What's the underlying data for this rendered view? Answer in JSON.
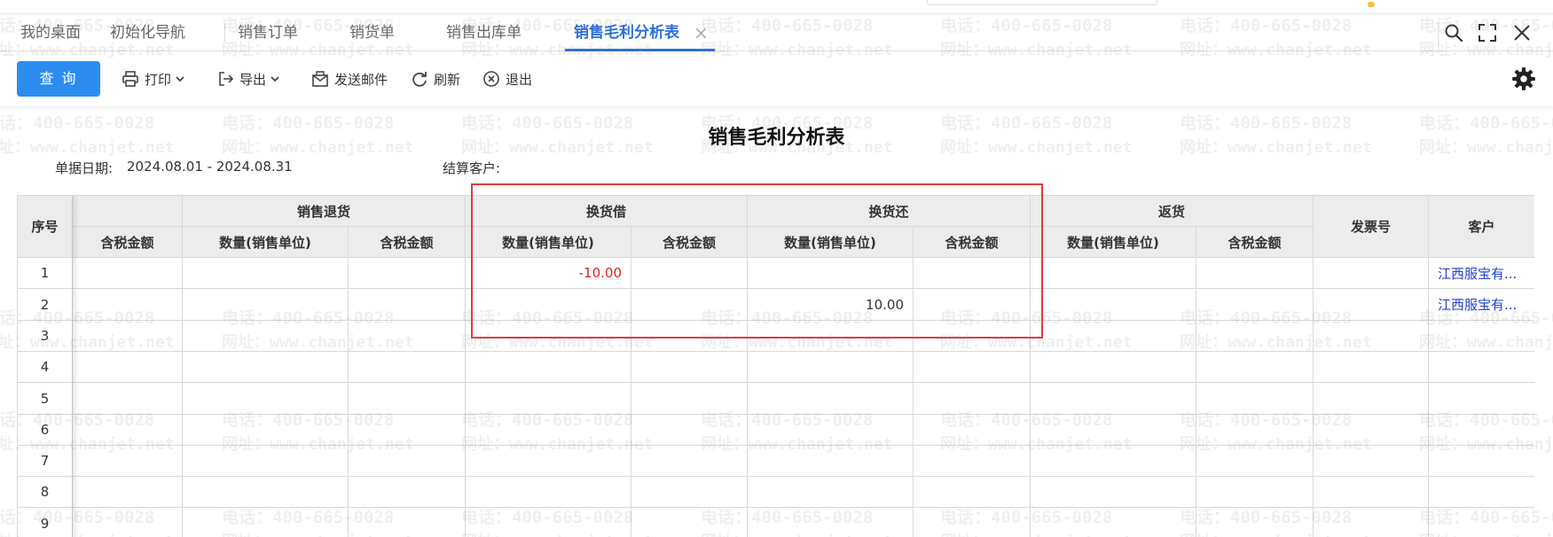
{
  "tabs": [
    {
      "label": "我的桌面",
      "active": false
    },
    {
      "label": "初始化导航",
      "active": false
    },
    {
      "label": "销售订单",
      "active": false
    },
    {
      "label": "销货单",
      "active": false
    },
    {
      "label": "销售出库单",
      "active": false
    },
    {
      "label": "销售毛利分析表",
      "active": true
    }
  ],
  "window_controls": [
    "search-icon",
    "maximize-icon",
    "close-icon"
  ],
  "toolbar": {
    "query_label": "查 询",
    "print_label": "打印",
    "export_label": "导出",
    "email_label": "发送邮件",
    "refresh_label": "刷新",
    "exit_label": "退出"
  },
  "report": {
    "title": "销售毛利分析表",
    "date_label": "单据日期:",
    "date_value": "2024.08.01 - 2024.08.31",
    "customer_label": "结算客户:",
    "customer_value": ""
  },
  "grid": {
    "seq_header": "序号",
    "groups": [
      "销售退货",
      "换货借",
      "换货还",
      "返货"
    ],
    "amount_header": "含税金额",
    "qty_header": "数量(销售单位)",
    "invoice_header": "发票号",
    "customer_header": "客户",
    "rows": [
      {
        "seq": "1",
        "exchange_borrow_qty": "-10.00",
        "exchange_return_qty": "",
        "customer": "江西服宝有..."
      },
      {
        "seq": "2",
        "exchange_borrow_qty": "",
        "exchange_return_qty": "10.00",
        "customer": "江西服宝有..."
      },
      {
        "seq": "3",
        "exchange_borrow_qty": "",
        "exchange_return_qty": "",
        "customer": ""
      },
      {
        "seq": "4",
        "exchange_borrow_qty": "",
        "exchange_return_qty": "",
        "customer": ""
      },
      {
        "seq": "5",
        "exchange_borrow_qty": "",
        "exchange_return_qty": "",
        "customer": ""
      },
      {
        "seq": "6",
        "exchange_borrow_qty": "",
        "exchange_return_qty": "",
        "customer": ""
      },
      {
        "seq": "7",
        "exchange_borrow_qty": "",
        "exchange_return_qty": "",
        "customer": ""
      },
      {
        "seq": "8",
        "exchange_borrow_qty": "",
        "exchange_return_qty": "",
        "customer": ""
      },
      {
        "seq": "9",
        "exchange_borrow_qty": "",
        "exchange_return_qty": "",
        "customer": ""
      }
    ]
  },
  "watermark": {
    "phone": "电话：400-665-0028",
    "site": "网址：www.chanjet.net"
  },
  "colors": {
    "accent": "#2b6fdc",
    "query_button": "#2d8cf0",
    "negative": "#e02020",
    "link": "#2240c8",
    "highlight": "#e03b3b"
  }
}
